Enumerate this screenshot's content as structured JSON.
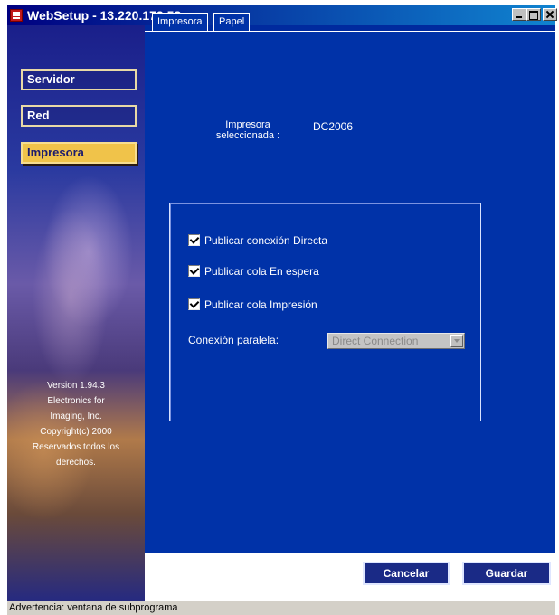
{
  "window": {
    "title": "WebSetup - 13.220.172.58"
  },
  "sidebar": {
    "items": [
      {
        "label": "Servidor",
        "active": false
      },
      {
        "label": "Red",
        "active": false
      },
      {
        "label": "Impresora",
        "active": true
      }
    ],
    "version_lines": [
      "Version 1.94.3",
      "Electronics for",
      "Imaging, Inc.",
      "Copyright(c) 2000",
      "Reservados todos los",
      "derechos."
    ]
  },
  "tabs": [
    {
      "label": "Impresora",
      "active": true
    },
    {
      "label": "Papel",
      "active": false
    }
  ],
  "printer": {
    "label_line1": "Impresora",
    "label_line2": "seleccionada :",
    "value": "DC2006"
  },
  "options": [
    {
      "label": "Publicar conexión Directa",
      "checked": true
    },
    {
      "label": "Publicar cola En espera",
      "checked": true
    },
    {
      "label": "Publicar cola Impresión",
      "checked": true
    }
  ],
  "connection": {
    "label": "Conexión paralela:",
    "value": "Direct Connection",
    "enabled": false
  },
  "buttons": {
    "cancel": "Cancelar",
    "save": "Guardar"
  },
  "status": {
    "text": "Advertencia: ventana de subprograma"
  },
  "colors": {
    "background": "#0032a8",
    "active_nav": "#f0c34a",
    "titlebar": "#000080"
  }
}
